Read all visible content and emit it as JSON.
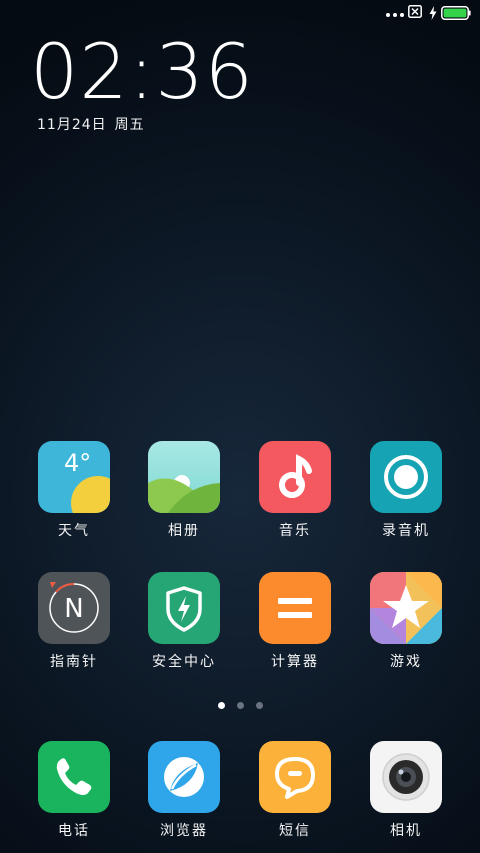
{
  "clock": {
    "time": "02:36",
    "date": "11月24日",
    "weekday": "周五"
  },
  "status_bar": {
    "icons": [
      "more-dots-icon",
      "no-sim-icon",
      "charging-bolt-icon",
      "battery-icon"
    ],
    "battery_color": "#35d34a"
  },
  "pages": {
    "count": 3,
    "active": 0
  },
  "apps": [
    {
      "id": "weather",
      "label": "天气",
      "icon": "weather-icon",
      "temp": "4°"
    },
    {
      "id": "gallery",
      "label": "相册",
      "icon": "gallery-icon"
    },
    {
      "id": "music",
      "label": "音乐",
      "icon": "music-note-icon"
    },
    {
      "id": "recorder",
      "label": "录音机",
      "icon": "recorder-icon"
    },
    {
      "id": "compass",
      "label": "指南针",
      "icon": "compass-icon",
      "letter": "N"
    },
    {
      "id": "security",
      "label": "安全中心",
      "icon": "shield-bolt-icon"
    },
    {
      "id": "calculator",
      "label": "计算器",
      "icon": "equals-icon"
    },
    {
      "id": "games",
      "label": "游戏",
      "icon": "star-icon"
    }
  ],
  "dock": [
    {
      "id": "phone",
      "label": "电话",
      "icon": "phone-icon"
    },
    {
      "id": "browser",
      "label": "浏览器",
      "icon": "browser-icon"
    },
    {
      "id": "messages",
      "label": "短信",
      "icon": "message-bubble-icon"
    },
    {
      "id": "camera",
      "label": "相机",
      "icon": "camera-lens-icon"
    }
  ]
}
